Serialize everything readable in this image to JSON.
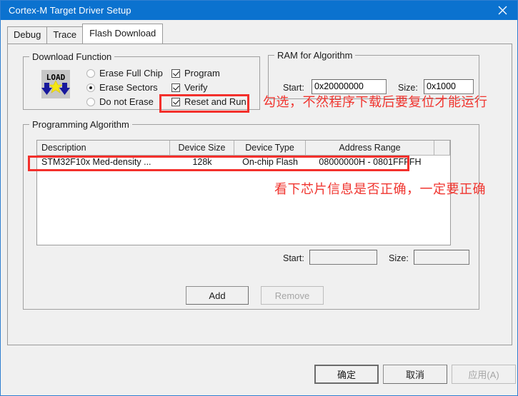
{
  "window": {
    "title": "Cortex-M Target Driver Setup",
    "close_icon": "close-icon",
    "titlebar_color": "#0b72cf"
  },
  "tabs": [
    {
      "label": "Debug",
      "active": false
    },
    {
      "label": "Trace",
      "active": false
    },
    {
      "label": "Flash Download",
      "active": true
    }
  ],
  "download_function": {
    "legend": "Download Function",
    "icon": "load-icon",
    "erase_options": [
      {
        "label": "Erase Full Chip",
        "selected": false
      },
      {
        "label": "Erase Sectors",
        "selected": true
      },
      {
        "label": "Do not Erase",
        "selected": false
      }
    ],
    "checkboxes": [
      {
        "label": "Program",
        "checked": true
      },
      {
        "label": "Verify",
        "checked": true
      },
      {
        "label": "Reset and Run",
        "checked": true
      }
    ]
  },
  "ram_for_algorithm": {
    "legend": "RAM for Algorithm",
    "start_label": "Start:",
    "start_value": "0x20000000",
    "size_label": "Size:",
    "size_value": "0x1000"
  },
  "programming_algorithm": {
    "legend": "Programming Algorithm",
    "columns": [
      "Description",
      "Device Size",
      "Device Type",
      "Address Range",
      ""
    ],
    "rows": [
      [
        "STM32F10x Med-density ...",
        "128k",
        "On-chip Flash",
        "08000000H - 0801FFFFH",
        ""
      ]
    ],
    "start_label": "Start:",
    "start_value": "",
    "size_label": "Size:",
    "size_value": "",
    "add_label": "Add",
    "remove_label": "Remove"
  },
  "footer": {
    "ok_label": "确定",
    "cancel_label": "取消",
    "apply_label": "应用(A)"
  },
  "annotations": {
    "color": "#f0352f",
    "reset_and_run_note": "勾选，不然程序下载后要复位才能运行",
    "chip_info_note": "看下芯片信息是否正确，一定要正确"
  }
}
